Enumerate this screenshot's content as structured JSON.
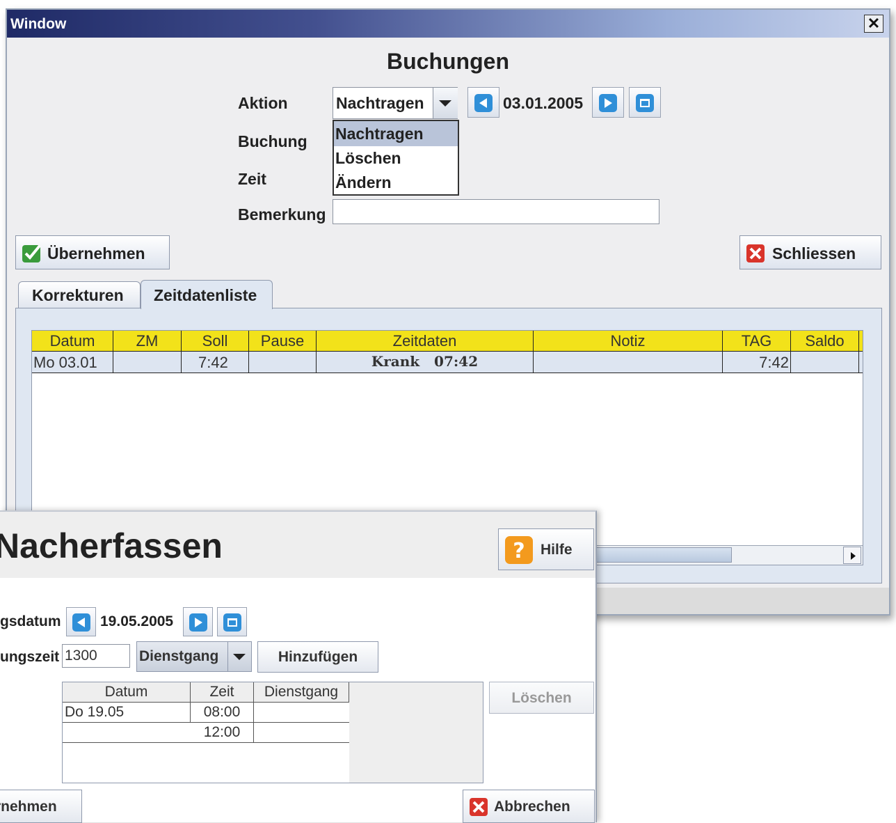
{
  "main_window": {
    "title": "Window",
    "close_label": "✕",
    "heading": "Buchungen",
    "labels": {
      "aktion": "Aktion",
      "buchung": "Buchung",
      "zeit": "Zeit",
      "bemerkung": "Bemerkung"
    },
    "aktion_select": {
      "value": "Nachtragen",
      "options": [
        "Nachtragen",
        "Löschen",
        "Ändern"
      ],
      "highlighted": "Nachtragen"
    },
    "date": "03.01.2005",
    "bemerkung_value": "",
    "buttons": {
      "apply": "Übernehmen",
      "close": "Schliessen"
    },
    "tabs": [
      {
        "label": "Korrekturen",
        "active": false
      },
      {
        "label": "Zeitdatenliste",
        "active": true
      }
    ],
    "table": {
      "columns": [
        "Datum",
        "ZM",
        "Soll",
        "Pause",
        "Zeitdaten",
        "Notiz",
        "TAG",
        "Saldo"
      ],
      "rows": [
        {
          "datum": "Mo 03.01",
          "zm": "",
          "soll": "7:42",
          "pause": "",
          "zeitdaten": "Krank   07:42",
          "notiz": "",
          "tag": "7:42",
          "saldo": ""
        }
      ],
      "header_color": "#f2e21a"
    }
  },
  "dialog": {
    "title": "Nacherfassen",
    "help_label": "Hilfe",
    "labels": {
      "datum": "gsdatum",
      "zeit": "ungszeit"
    },
    "date": "19.05.2005",
    "time_value": "1300",
    "type_select": "Dienstgang",
    "add_button": "Hinzufügen",
    "delete_button": "Löschen",
    "apply_button": "rnehmen",
    "cancel_button": "Abbrechen",
    "table": {
      "columns": [
        "Datum",
        "Zeit",
        "Dienstgang"
      ],
      "rows": [
        {
          "datum": "Do 19.05",
          "zeit": "08:00",
          "dienstgang": ""
        },
        {
          "datum": "",
          "zeit": "12:00",
          "dienstgang": ""
        }
      ]
    }
  }
}
